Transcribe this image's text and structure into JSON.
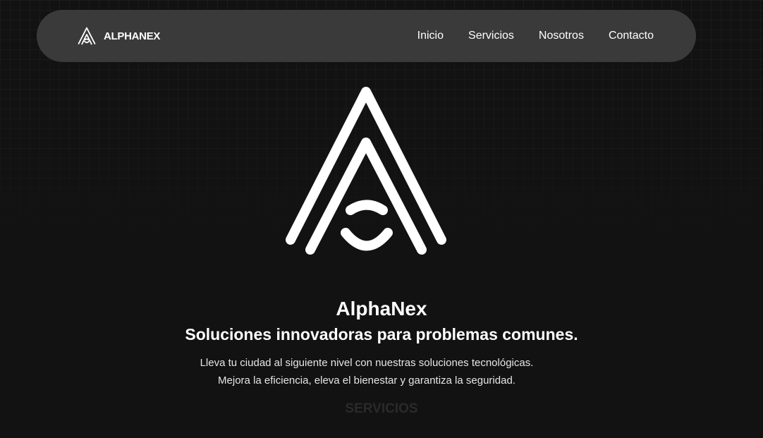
{
  "nav": {
    "brand_name": "ALPHANEX",
    "brand_icon": "alphanex-logo-icon",
    "links": [
      {
        "label": "Inicio"
      },
      {
        "label": "Servicios"
      },
      {
        "label": "Nosotros"
      },
      {
        "label": "Contacto"
      }
    ]
  },
  "hero": {
    "logo_icon": "alphanex-logo",
    "title": "AlphaNex",
    "subtitle": "Soluciones innovadoras para problemas comunes.",
    "description": "Lleva tu ciudad al siguiente nivel con nuestras soluciones tecnológicas. Mejora la eficiencia, eleva el bienestar y garantiza la seguridad."
  },
  "next_section": {
    "heading": "SERVICIOS"
  },
  "colors": {
    "background": "#121212",
    "navbar": "#3a3a3a",
    "text": "#ffffff"
  }
}
